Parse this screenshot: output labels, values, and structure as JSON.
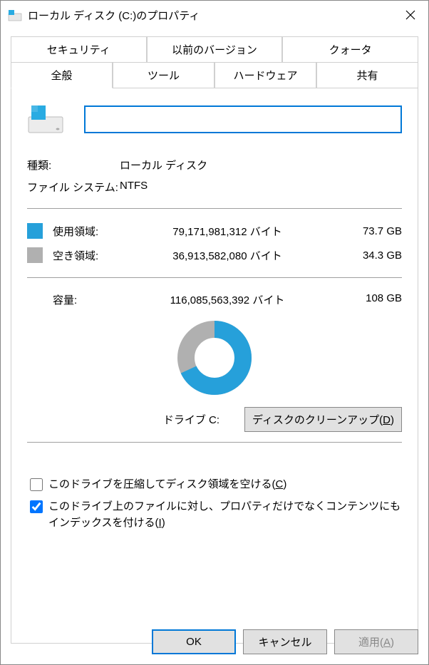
{
  "window": {
    "title": "ローカル ディスク (C:)のプロパティ"
  },
  "tabs": {
    "security": "セキュリティ",
    "prev_versions": "以前のバージョン",
    "quota": "クォータ",
    "general": "全般",
    "tools": "ツール",
    "hardware": "ハードウェア",
    "sharing": "共有"
  },
  "name_input": {
    "value": ""
  },
  "type": {
    "label": "種類:",
    "value": "ローカル ディスク"
  },
  "filesystem": {
    "label": "ファイル システム:",
    "value": "NTFS"
  },
  "used": {
    "label": "使用領域:",
    "bytes": "79,171,981,312 バイト",
    "gb": "73.7 GB",
    "color": "#26a0da"
  },
  "free": {
    "label": "空き領域:",
    "bytes": "36,913,582,080 バイト",
    "gb": "34.3 GB",
    "color": "#b0b0b0"
  },
  "capacity": {
    "label": "容量:",
    "bytes": "116,085,563,392 バイト",
    "gb": "108 GB"
  },
  "drive_label": "ドライブ C:",
  "cleanup_button": "ディスクのクリーンアップ(",
  "cleanup_button_key": "D",
  "cleanup_button_end": ")",
  "compress": {
    "label": "このドライブを圧縮してディスク領域を空ける(",
    "key": "C",
    "end": ")",
    "checked": false
  },
  "index": {
    "label": "このドライブ上のファイルに対し、プロパティだけでなくコンテンツにもインデックスを付ける(",
    "key": "I",
    "end": ")",
    "checked": true
  },
  "buttons": {
    "ok": "OK",
    "cancel": "キャンセル",
    "apply": "適用(",
    "apply_key": "A",
    "apply_end": ")"
  },
  "chart_data": {
    "type": "pie",
    "title": "ドライブ C:",
    "categories": [
      "使用領域",
      "空き領域"
    ],
    "values": [
      79171981312,
      36913582080
    ],
    "series": [
      {
        "name": "使用領域",
        "value": 73.7,
        "unit": "GB",
        "color": "#26a0da"
      },
      {
        "name": "空き領域",
        "value": 34.3,
        "unit": "GB",
        "color": "#b0b0b0"
      }
    ],
    "total": 108
  }
}
